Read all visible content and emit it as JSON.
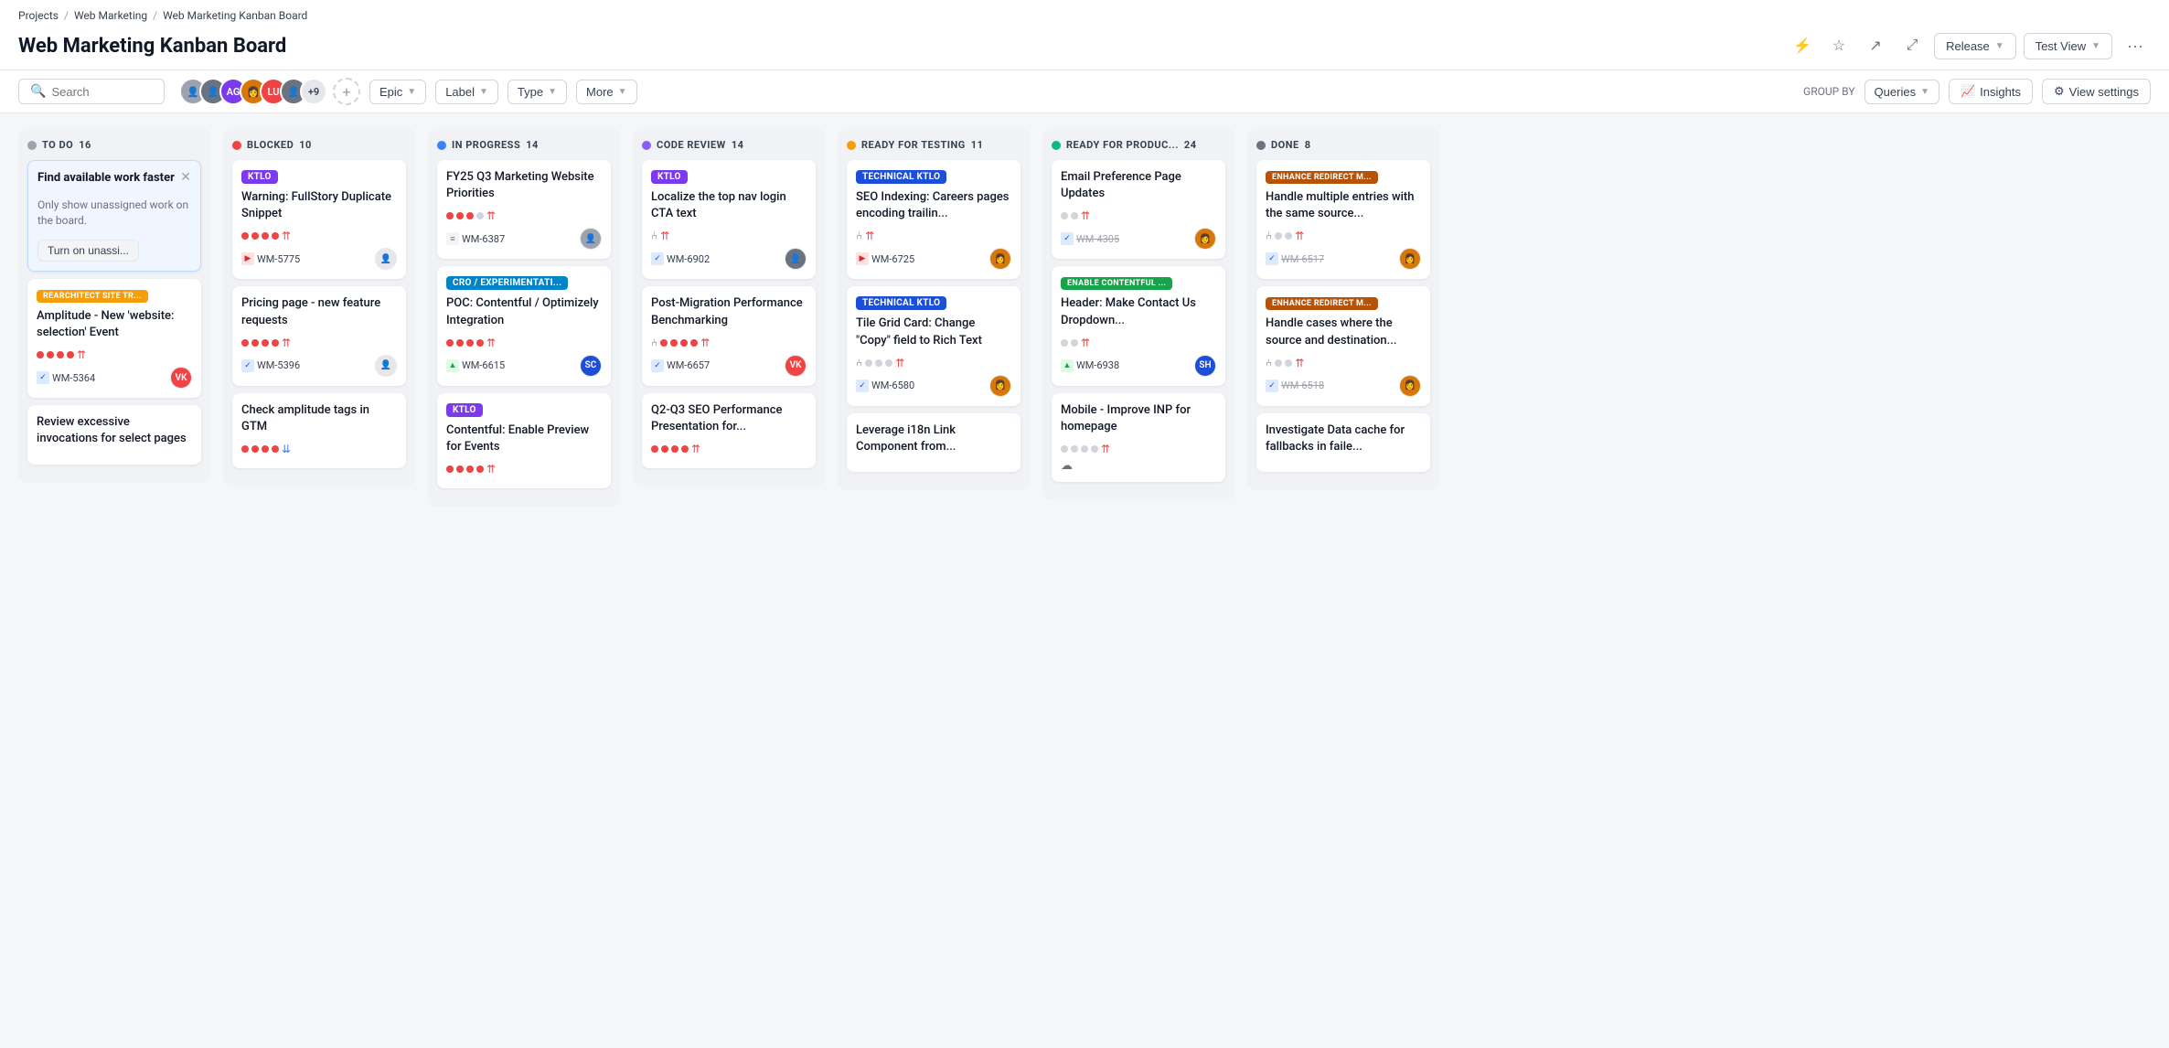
{
  "breadcrumb": {
    "items": [
      "Projects",
      "Web Marketing",
      "Web Marketing Kanban Board"
    ]
  },
  "page": {
    "title": "Web Marketing Kanban Board"
  },
  "header": {
    "release_label": "Release",
    "test_view_label": "Test View"
  },
  "toolbar": {
    "search_placeholder": "Search",
    "epic_label": "Epic",
    "label_label": "Label",
    "type_label": "Type",
    "more_label": "More",
    "group_by_label": "GROUP BY",
    "queries_label": "Queries",
    "insights_label": "Insights",
    "view_settings_label": "View settings",
    "avatars_extra": "+9"
  },
  "columns": [
    {
      "id": "todo",
      "title": "TO DO",
      "count": 16,
      "dot_class": "dot-todo",
      "cards": [
        {
          "id": "highlight",
          "title": "Find available work faster",
          "subtitle": "Only show unassigned work on the board.",
          "button": "Turn on unassi...",
          "highlight": true
        },
        {
          "id": "c1",
          "title": "Amplitude - New 'website: selection' Event",
          "tag": "REARCHITECT SITE TR...",
          "tag_class": "tag-rearchitect",
          "dots": [
            "red",
            "red",
            "red",
            "red"
          ],
          "priority": "up",
          "wm": "WM-5364",
          "wm_icon": "blue",
          "wm_prefix": "✓",
          "avatar_color": "#ef4444",
          "avatar_text": "VK",
          "avatar_bg": "#ef4444"
        },
        {
          "id": "c2",
          "title": "Review excessive invocations for select pages",
          "tag": null,
          "dots": [],
          "priority": null,
          "wm": null,
          "avatar_color": null,
          "avatar_text": null
        }
      ]
    },
    {
      "id": "blocked",
      "title": "BLOCKED",
      "count": 10,
      "dot_class": "dot-blocked",
      "cards": [
        {
          "id": "b1",
          "title": "Warning: FullStory Duplicate Snippet",
          "tag": "KTLO",
          "tag_class": "tag-ktlo",
          "dots": [
            "red",
            "red",
            "red",
            "red"
          ],
          "priority": "up",
          "wm": "WM-5775",
          "wm_icon": "red",
          "wm_prefix": "▶",
          "avatar_text": "👤",
          "avatar_bg": "#e5e7eb"
        },
        {
          "id": "b2",
          "title": "Pricing page - new feature requests",
          "tag": null,
          "dots": [
            "red",
            "red",
            "red",
            "red"
          ],
          "priority": "up",
          "wm": "WM-5396",
          "wm_icon": "blue",
          "wm_prefix": "✓",
          "avatar_text": "👤",
          "avatar_bg": "#e5e7eb"
        },
        {
          "id": "b3",
          "title": "Check amplitude tags in GTM",
          "tag": null,
          "dots": [
            "red",
            "red",
            "red",
            "red"
          ],
          "priority": "down",
          "wm": null,
          "avatar_text": null
        }
      ]
    },
    {
      "id": "inprogress",
      "title": "IN PROGRESS",
      "count": 14,
      "dot_class": "dot-inprogress",
      "cards": [
        {
          "id": "ip1",
          "title": "FY25 Q3 Marketing Website Priorities",
          "tag": null,
          "dots": [
            "red",
            "red",
            "red",
            "gray"
          ],
          "priority": "up",
          "wm": "WM-6387",
          "wm_icon": "gray",
          "wm_prefix": "≡",
          "avatar_text": "👤",
          "avatar_bg": "#9ca3af"
        },
        {
          "id": "ip2",
          "title": "POC: Contentful / Optimizely Integration",
          "tag": "CRO / EXPERIMENTATI...",
          "tag_class": "tag-cro",
          "dots": [
            "red",
            "red",
            "red",
            "red"
          ],
          "priority": "up",
          "wm": "WM-6615",
          "wm_icon": "green",
          "wm_prefix": "▲",
          "avatar_text": "SC",
          "avatar_bg": "#1d4ed8"
        },
        {
          "id": "ip3",
          "title": "Contentful: Enable Preview for Events",
          "tag": "KTLO",
          "tag_class": "tag-ktlo",
          "dots": [
            "red",
            "red",
            "red",
            "red"
          ],
          "priority": "up",
          "wm": null,
          "avatar_text": null
        }
      ]
    },
    {
      "id": "codereview",
      "title": "CODE REVIEW",
      "count": 14,
      "dot_class": "dot-codereview",
      "cards": [
        {
          "id": "cr1",
          "title": "Localize the top nav login CTA text",
          "tag": "KTLO",
          "tag_class": "tag-ktlo",
          "dots": [],
          "priority": "up",
          "wm": "WM-6902",
          "wm_icon": "blue",
          "wm_prefix": "✓",
          "avatar_text": "👤",
          "avatar_bg": "#6b7280",
          "merge_icon": true
        },
        {
          "id": "cr2",
          "title": "Post-Migration Performance Benchmarking",
          "tag": null,
          "dots": [
            "red",
            "red",
            "red",
            "red"
          ],
          "priority": "up",
          "wm": "WM-6657",
          "wm_icon": "blue",
          "wm_prefix": "✓",
          "avatar_text": "VK",
          "avatar_bg": "#ef4444",
          "merge_icon": true
        },
        {
          "id": "cr3",
          "title": "Q2-Q3 SEO Performance Presentation for...",
          "tag": null,
          "dots": [
            "red",
            "red",
            "red",
            "red"
          ],
          "priority": "up",
          "wm": null,
          "avatar_text": null
        }
      ]
    },
    {
      "id": "testing",
      "title": "READY FOR TESTING",
      "count": 11,
      "dot_class": "dot-testing",
      "cards": [
        {
          "id": "t1",
          "title": "SEO Indexing: Careers pages encoding trailin...",
          "tag": "TECHNICAL KTLO",
          "tag_class": "tag-technical-ktlo",
          "dots": [],
          "priority": "up",
          "wm": "WM-6725",
          "wm_icon": "red",
          "wm_prefix": "▶",
          "avatar_text": "👩",
          "avatar_bg": "#d97706",
          "merge_icon": true
        },
        {
          "id": "t2",
          "title": "Tile Grid Card: Change \"Copy\" field to Rich Text",
          "tag": "TECHNICAL KTLO",
          "tag_class": "tag-technical-ktlo",
          "dots": [
            "gray",
            "gray",
            "gray"
          ],
          "priority": "up",
          "wm": "WM-6580",
          "wm_icon": "blue",
          "wm_prefix": "✓",
          "avatar_text": "👩",
          "avatar_bg": "#d97706",
          "merge_icon": true
        },
        {
          "id": "t3",
          "title": "Leverage i18n Link Component from...",
          "tag": null,
          "dots": [],
          "priority": null,
          "wm": null,
          "avatar_text": null
        }
      ]
    },
    {
      "id": "prodready",
      "title": "READY FOR PRODUC...",
      "count": 24,
      "dot_class": "dot-prodready",
      "cards": [
        {
          "id": "pr1",
          "title": "Email Preference Page Updates",
          "tag": null,
          "wm": "WM-4305",
          "wm_prefix": "✓",
          "wm_icon": "blue",
          "strikethrough": true,
          "dots": [
            "gray",
            "gray"
          ],
          "priority": "up",
          "avatar_text": "👩",
          "avatar_bg": "#d97706"
        },
        {
          "id": "pr2",
          "title": "Header: Make Contact Us Dropdown...",
          "tag": "ENABLE CONTENTFUL ...",
          "tag_class": "tag-enable-contentful",
          "wm": "WM-6938",
          "wm_prefix": "▲",
          "wm_icon": "green",
          "dots": [
            "gray",
            "gray"
          ],
          "priority": "up",
          "avatar_text": "SH",
          "avatar_bg": "#1d4ed8"
        },
        {
          "id": "pr3",
          "title": "Mobile - Improve INP for homepage",
          "tag": null,
          "dots": [
            "gray",
            "gray",
            "gray",
            "gray"
          ],
          "priority": "up",
          "wm": null,
          "avatar_text": null,
          "cloud_icon": true
        }
      ]
    },
    {
      "id": "done",
      "title": "DONE",
      "count": 8,
      "dot_class": "dot-done",
      "cards": [
        {
          "id": "d1",
          "title": "Handle multiple entries with the same source...",
          "tag": "ENHANCE REDIRECT M...",
          "tag_class": "tag-enhance-redirect",
          "dots": [
            "gray",
            "gray"
          ],
          "priority": "up",
          "wm": "WM-6517",
          "wm_prefix": "✓",
          "wm_icon": "blue",
          "strikethrough": true,
          "avatar_text": "👩",
          "avatar_bg": "#d97706",
          "merge_icon": true
        },
        {
          "id": "d2",
          "title": "Handle cases where the source and destination...",
          "tag": "ENHANCE REDIRECT M...",
          "tag_class": "tag-enhance-redirect",
          "dots": [
            "gray",
            "gray"
          ],
          "priority": "up",
          "wm": "WM-6518",
          "wm_prefix": "✓",
          "wm_icon": "blue",
          "strikethrough": true,
          "avatar_text": "👩",
          "avatar_bg": "#d97706",
          "merge_icon": true
        },
        {
          "id": "d3",
          "title": "Investigate Data cache for fallbacks in faile...",
          "tag": null,
          "dots": [],
          "priority": null,
          "wm": null,
          "avatar_text": null
        }
      ]
    }
  ]
}
